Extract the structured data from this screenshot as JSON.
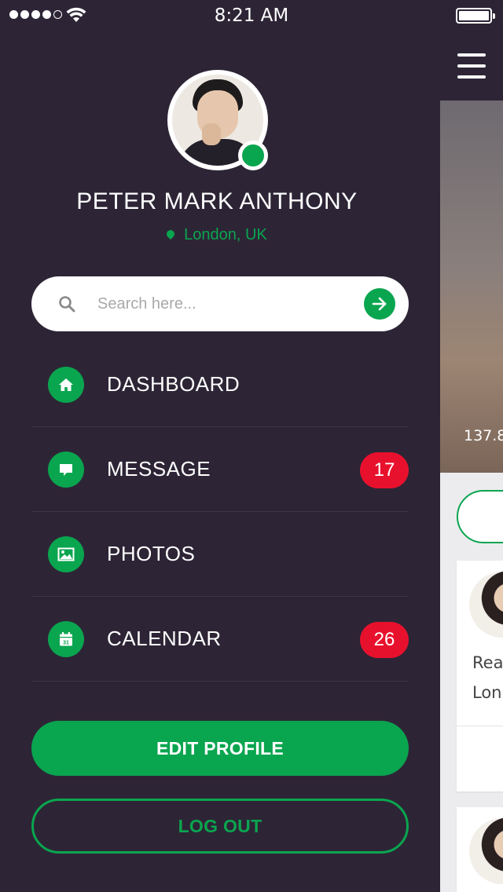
{
  "status_bar": {
    "time": "8:21 AM",
    "signal_bars_filled": 4,
    "signal_bars_total": 5
  },
  "profile": {
    "name": "PETER MARK ANTHONY",
    "location": "London, UK",
    "online": true
  },
  "search": {
    "placeholder": "Search here..."
  },
  "menu": {
    "items": [
      {
        "label": "DASHBOARD",
        "icon": "home-icon",
        "badge": ""
      },
      {
        "label": "MESSAGE",
        "icon": "message-icon",
        "badge": "17"
      },
      {
        "label": "PHOTOS",
        "icon": "image-icon",
        "badge": ""
      },
      {
        "label": "CALENDAR",
        "icon": "calendar-icon",
        "badge": "26"
      }
    ],
    "calendar_icon_day": "31"
  },
  "buttons": {
    "edit_profile": "EDIT PROFILE",
    "log_out": "LOG OUT"
  },
  "main_peek": {
    "stat_number": "137.8",
    "card_text_line1": "Rea",
    "card_text_line2": "Lon"
  },
  "colors": {
    "background": "#2d2536",
    "accent_green": "#0aa54f",
    "badge_red": "#e8112d",
    "divider": "#3d3546"
  }
}
